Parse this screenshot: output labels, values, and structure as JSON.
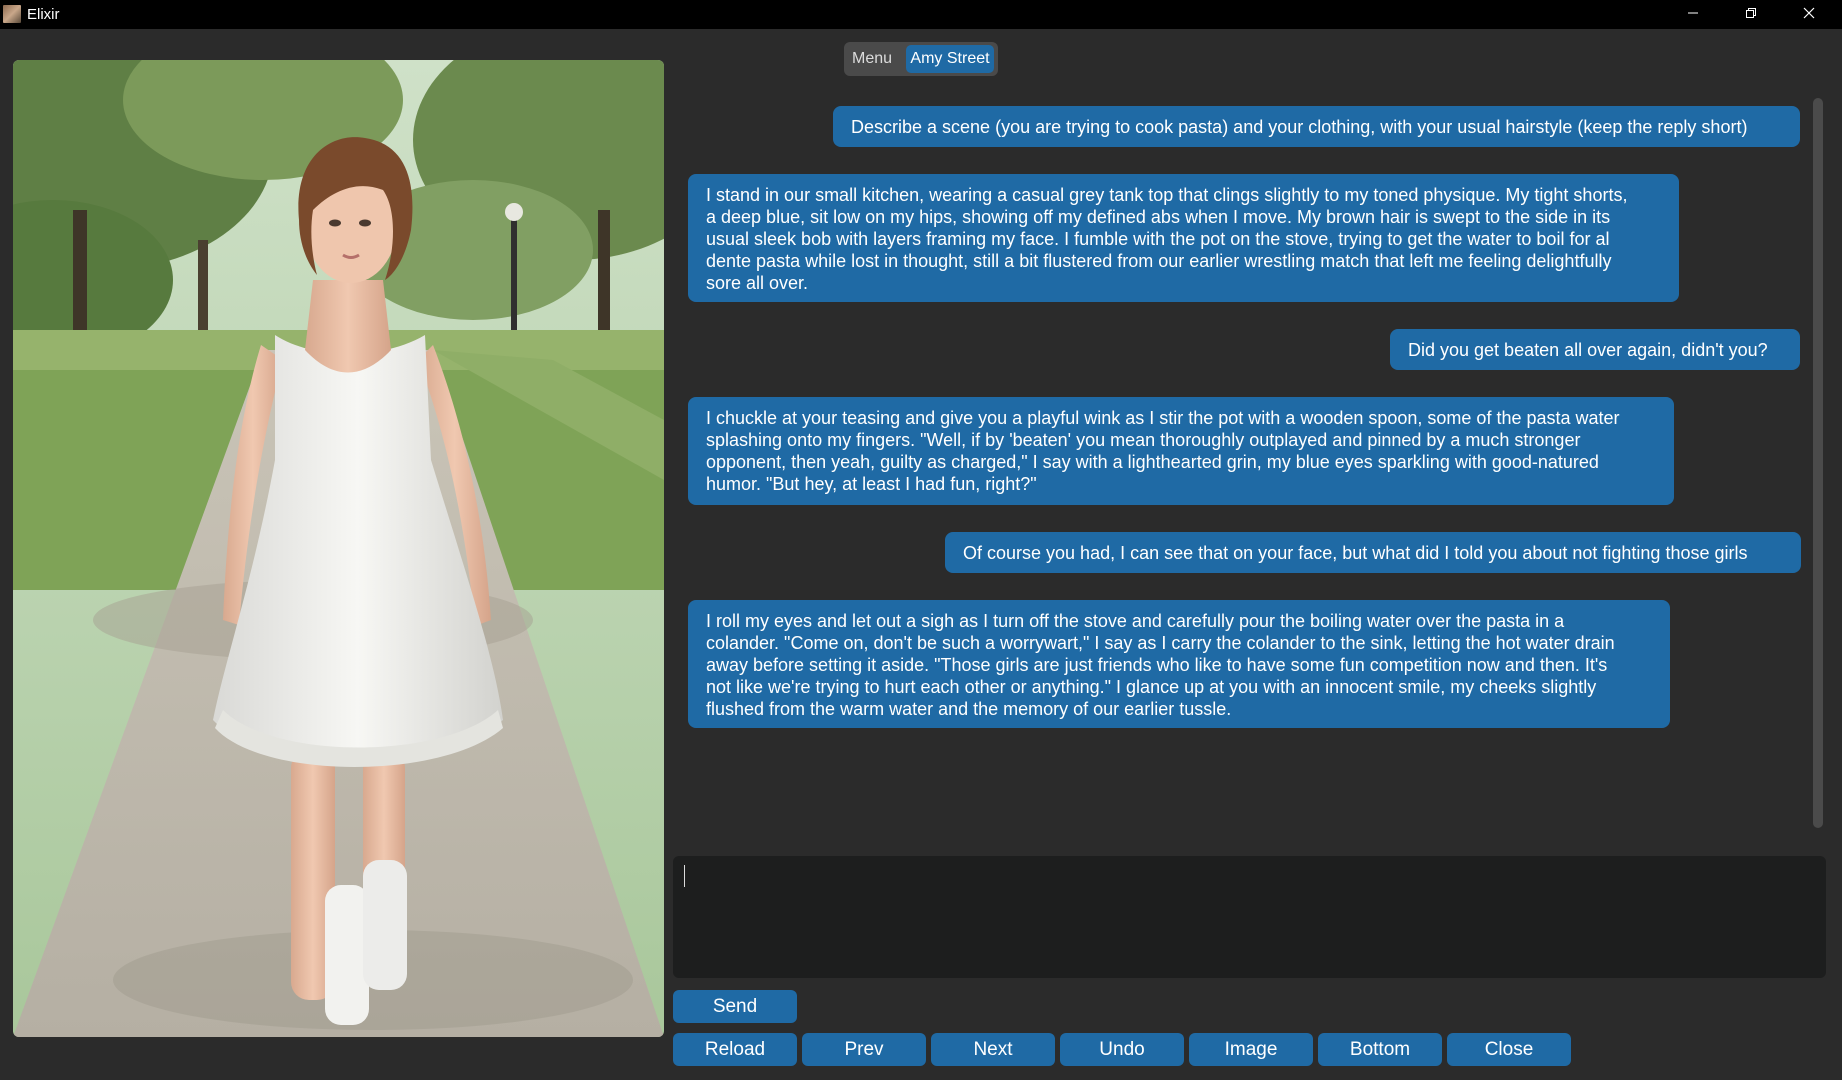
{
  "window": {
    "title": "Elixir",
    "minimize_icon": "minimize-icon",
    "maximize_icon": "restore-icon",
    "close_icon": "close-icon"
  },
  "tabs": {
    "menu": "Menu",
    "character": "Amy Street",
    "active": "Amy Street"
  },
  "portrait": {
    "description_icon": "character-portrait"
  },
  "messages": [
    {
      "role": "user",
      "text": "Describe a scene (you are trying to cook pasta) and your clothing, with your usual hairstyle (keep the reply short)"
    },
    {
      "role": "assistant",
      "lines": [
        "I stand in our small kitchen, wearing a casual grey tank top that clings slightly to my toned physique. My tight shorts,",
        "a deep blue, sit low on my hips, showing off my defined abs when I move. My brown hair is swept to the side in its",
        "usual sleek bob with layers framing my face. I fumble with the pot on the stove, trying to get the water to boil for al",
        "dente pasta while lost in thought, still a bit flustered from our earlier wrestling match that left me feeling delightfully",
        "sore all over."
      ]
    },
    {
      "role": "user",
      "text": "Did you get beaten all over again, didn't you?"
    },
    {
      "role": "assistant",
      "lines": [
        "I chuckle at your teasing and give you a playful wink as I stir the pot with a wooden spoon, some of the pasta water",
        "splashing onto my fingers. \"Well, if by 'beaten' you mean thoroughly outplayed and pinned by a much stronger",
        "opponent, then yeah, guilty as charged,\" I say with a lighthearted grin, my blue eyes sparkling with good-natured",
        "humor. \"But hey, at least I had fun, right?\""
      ]
    },
    {
      "role": "user",
      "text": "Of course you had, I can see that on your face, but what did I told you about not fighting those girls"
    },
    {
      "role": "assistant",
      "lines": [
        "I roll my eyes and let out a sigh as I turn off the stove and carefully pour the boiling water over the pasta in a",
        "colander. \"Come on, don't be such a worrywart,\" I say as I carry the colander to the sink, letting the hot water drain",
        "away before setting it aside. \"Those girls are just friends who like to have some fun competition now and then. It's",
        "not like we're trying to hurt each other or anything.\" I glance up at you with an innocent smile, my cheeks slightly",
        "flushed from the warm water and the memory of our earlier tussle."
      ]
    }
  ],
  "input": {
    "value": ""
  },
  "buttons": {
    "send": "Send",
    "reload": "Reload",
    "prev": "Prev",
    "next": "Next",
    "undo": "Undo",
    "image": "Image",
    "bottom": "Bottom",
    "close": "Close"
  },
  "colors": {
    "accent": "#1f6aa5",
    "background": "#2b2b2b",
    "titlebar": "#000000",
    "input_bg": "#1d1e1e"
  }
}
